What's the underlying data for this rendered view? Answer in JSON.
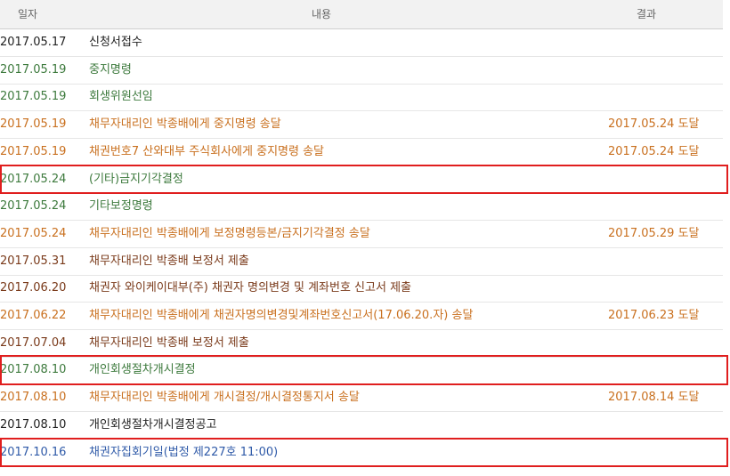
{
  "header": {
    "date": "일자",
    "content": "내용",
    "result": "결과"
  },
  "colors": {
    "black": "#222222",
    "green": "#3d7a3d",
    "orange": "#c9701f",
    "brown": "#7a3a1a",
    "blue": "#2f5aa8",
    "highlight": "#e01e1e"
  },
  "rows": [
    {
      "date": "2017.05.17",
      "content": "신청서접수",
      "result": "",
      "color": "black",
      "highlighted": false
    },
    {
      "date": "2017.05.19",
      "content": "중지명령",
      "result": "",
      "color": "green",
      "highlighted": false
    },
    {
      "date": "2017.05.19",
      "content": "회생위원선임",
      "result": "",
      "color": "green",
      "highlighted": false
    },
    {
      "date": "2017.05.19",
      "content": "채무자대리인 박종배에게 중지명령 송달",
      "result": "2017.05.24 도달",
      "color": "orange",
      "highlighted": false
    },
    {
      "date": "2017.05.19",
      "content": "채권번호7 산와대부 주식회사에게 중지명령 송달",
      "result": "2017.05.24 도달",
      "color": "orange",
      "highlighted": false
    },
    {
      "date": "2017.05.24",
      "content": "(기타)금지기각결정",
      "result": "",
      "color": "green",
      "highlighted": true
    },
    {
      "date": "2017.05.24",
      "content": "기타보정명령",
      "result": "",
      "color": "green",
      "highlighted": false
    },
    {
      "date": "2017.05.24",
      "content": "채무자대리인 박종배에게 보정명령등본/금지기각결정 송달",
      "result": "2017.05.29 도달",
      "color": "orange",
      "highlighted": false
    },
    {
      "date": "2017.05.31",
      "content": "채무자대리인 박종배 보정서 제출",
      "result": "",
      "color": "brown",
      "highlighted": false
    },
    {
      "date": "2017.06.20",
      "content": "채권자 와이케이대부(주) 채권자 명의변경 및 계좌번호 신고서 제출",
      "result": "",
      "color": "brown",
      "highlighted": false
    },
    {
      "date": "2017.06.22",
      "content": "채무자대리인 박종배에게 채권자명의변경및계좌번호신고서(17.06.20.자) 송달",
      "result": "2017.06.23 도달",
      "color": "orange",
      "highlighted": false
    },
    {
      "date": "2017.07.04",
      "content": "채무자대리인 박종배 보정서 제출",
      "result": "",
      "color": "brown",
      "highlighted": false
    },
    {
      "date": "2017.08.10",
      "content": "개인회생절차개시결정",
      "result": "",
      "color": "green",
      "highlighted": true
    },
    {
      "date": "2017.08.10",
      "content": "채무자대리인 박종배에게 개시결정/개시결정통지서 송달",
      "result": "2017.08.14 도달",
      "color": "orange",
      "highlighted": false
    },
    {
      "date": "2017.08.10",
      "content": "개인회생절차개시결정공고",
      "result": "",
      "color": "black",
      "highlighted": false
    },
    {
      "date": "2017.10.16",
      "content": "채권자집회기일(법정 제227호 11:00)",
      "result": "",
      "color": "blue",
      "highlighted": true
    }
  ]
}
